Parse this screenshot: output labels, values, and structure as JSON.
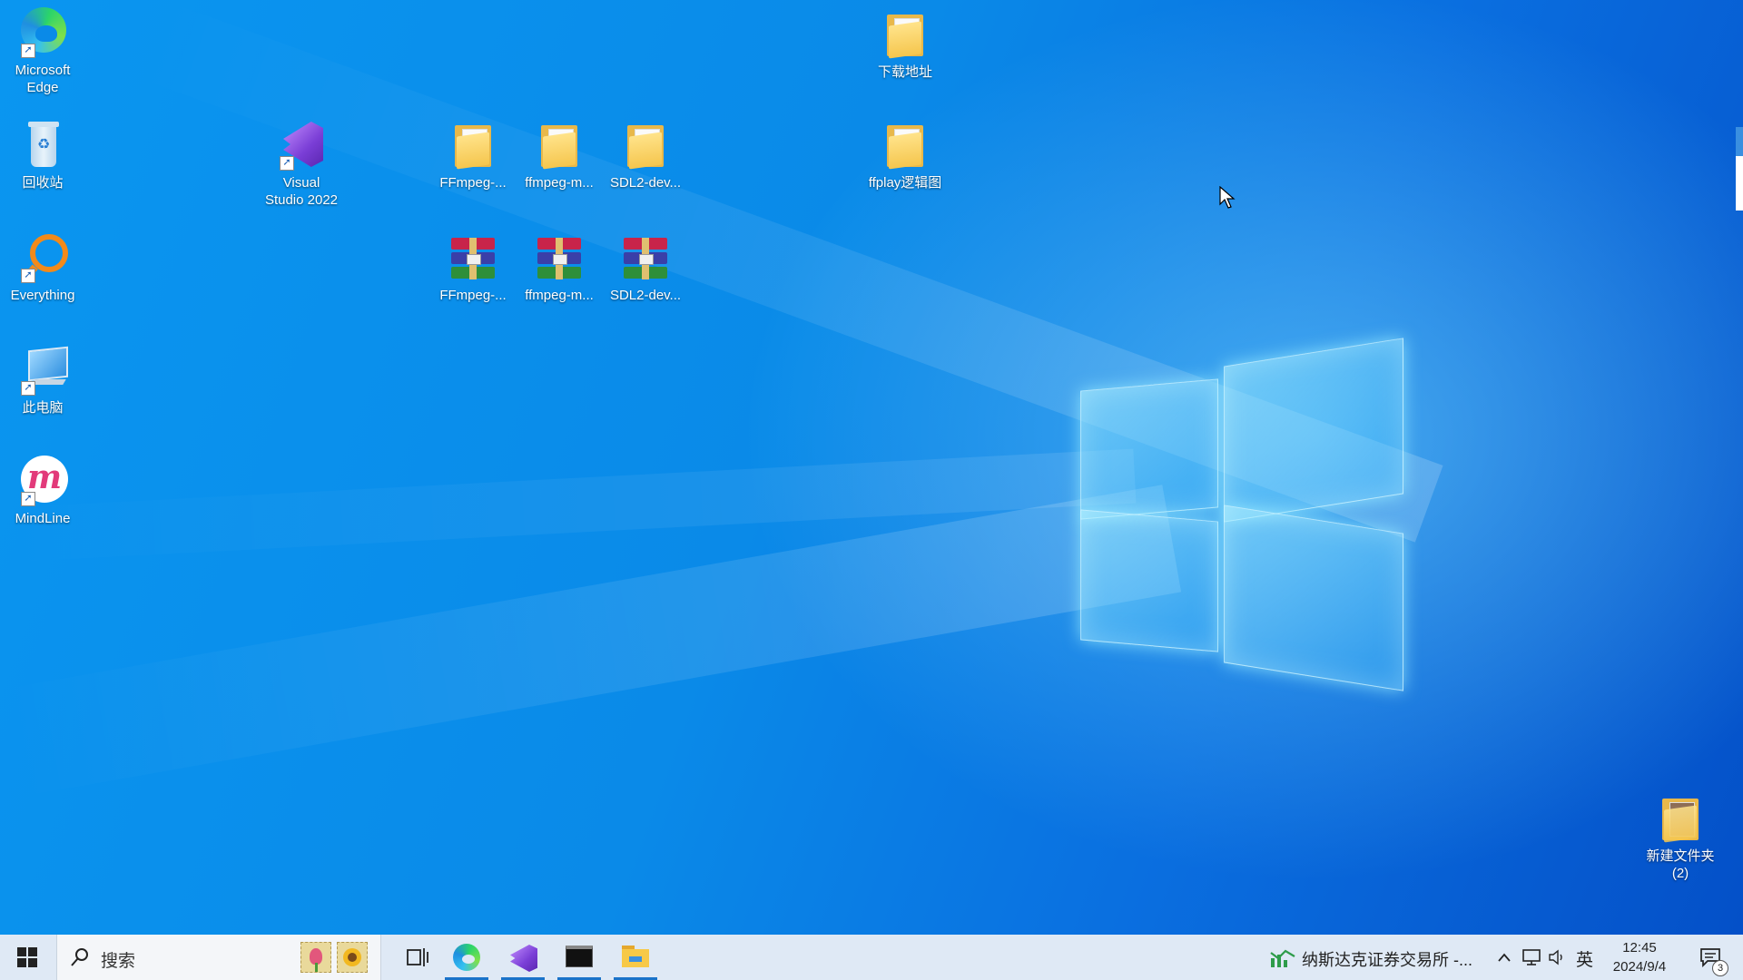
{
  "desktop": {
    "icons": {
      "edge": {
        "label1": "Microsoft",
        "label2": "Edge"
      },
      "recycle": {
        "label": "回收站"
      },
      "everything": {
        "label": "Everything"
      },
      "this_pc": {
        "label": "此电脑"
      },
      "mindline": {
        "label": "MindLine"
      },
      "vs": {
        "label1": "Visual",
        "label2": "Studio 2022"
      },
      "folder_ffmpeg": {
        "label": "FFmpeg-..."
      },
      "folder_ffmpeg_m": {
        "label": "ffmpeg-m..."
      },
      "folder_sdl2": {
        "label": "SDL2-dev..."
      },
      "rar_ffmpeg": {
        "label": "FFmpeg-..."
      },
      "rar_ffmpeg_m": {
        "label": "ffmpeg-m..."
      },
      "rar_sdl2": {
        "label": "SDL2-dev..."
      },
      "folder_download": {
        "label": "下载地址"
      },
      "folder_ffplay": {
        "label": "ffplay逻辑图"
      },
      "folder_new": {
        "label1": "新建文件夹",
        "label2": "(2)"
      }
    }
  },
  "taskbar": {
    "search_placeholder": "搜索",
    "apps": [
      "edge-icon",
      "visual-studio-icon",
      "terminal-icon",
      "file-explorer-icon"
    ],
    "news_text": "纳斯达克证券交易所 -...",
    "ime": "英",
    "time": "12:45",
    "date": "2024/9/4",
    "notification_count": "3"
  },
  "colors": {
    "desktop_blue": "#0a8ae8",
    "taskbar": "#dfe9f5",
    "active_indicator": "#1a73c9"
  }
}
